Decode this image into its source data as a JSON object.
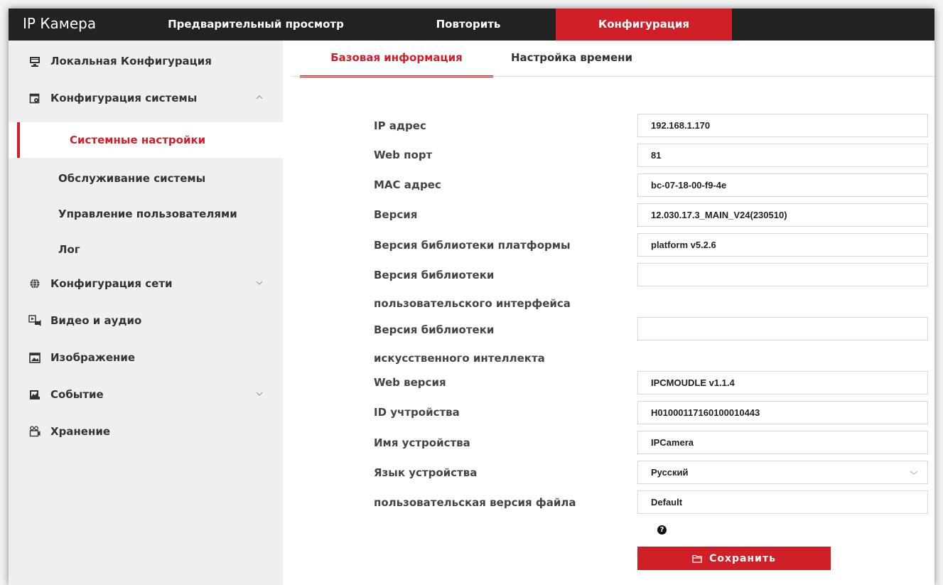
{
  "header": {
    "app_title": "IP Камера",
    "tabs": [
      {
        "label": "Предварительный просмотр"
      },
      {
        "label": "Повторить"
      },
      {
        "label": "Конфигурация",
        "active": true
      }
    ]
  },
  "sidebar": {
    "items": [
      {
        "label": "Локальная Конфигурация",
        "icon": "monitor-icon"
      },
      {
        "label": "Конфигурация системы",
        "icon": "system-settings-icon",
        "expanded": true
      },
      {
        "label": "Конфигурация сети",
        "icon": "globe-icon"
      },
      {
        "label": "Видео и аудио",
        "icon": "video-audio-icon"
      },
      {
        "label": "Изображение",
        "icon": "image-icon"
      },
      {
        "label": "Событие",
        "icon": "event-icon"
      },
      {
        "label": "Хранение",
        "icon": "storage-icon"
      }
    ],
    "subitems": [
      {
        "label": "Системные настройки",
        "active": true
      },
      {
        "label": "Обслуживание системы"
      },
      {
        "label": "Управление пользователями"
      },
      {
        "label": "Лог"
      }
    ]
  },
  "content": {
    "tabs": [
      {
        "label": "Базовая информация",
        "active": true
      },
      {
        "label": "Настройка времени"
      }
    ],
    "fields": [
      {
        "label": "IP адрес",
        "value": "192.168.1.170"
      },
      {
        "label": "Web порт",
        "value": "81"
      },
      {
        "label": "MAC адрес",
        "value": "bc-07-18-00-f9-4e"
      },
      {
        "label": "Версия",
        "value": "12.030.17.3_MAIN_V24(230510)"
      },
      {
        "label": "Версия библиотеки платформы",
        "value": "platform v5.2.6"
      },
      {
        "label_line1": "Версия библиотеки",
        "label_line2": "пользовательского интерфейса",
        "value": ""
      },
      {
        "label_line1": "Версия библиотеки",
        "label_line2": "искусственного интеллекта",
        "value": ""
      },
      {
        "label": "Web версия",
        "value": "IPCMOUDLE v1.1.4"
      },
      {
        "label": "ID учтройства",
        "value": "H01000117160100010443"
      },
      {
        "label": "Имя устройства",
        "value": "IPCamera"
      },
      {
        "label": "Язык устройства",
        "value": "Русский"
      },
      {
        "label": "пользовательская версия файла",
        "value": "Default"
      }
    ],
    "help_icon": "?",
    "save_label": "Сохранить"
  },
  "colors": {
    "accent": "#d11f28",
    "topbar": "#222222",
    "sidebar": "#efefef"
  }
}
